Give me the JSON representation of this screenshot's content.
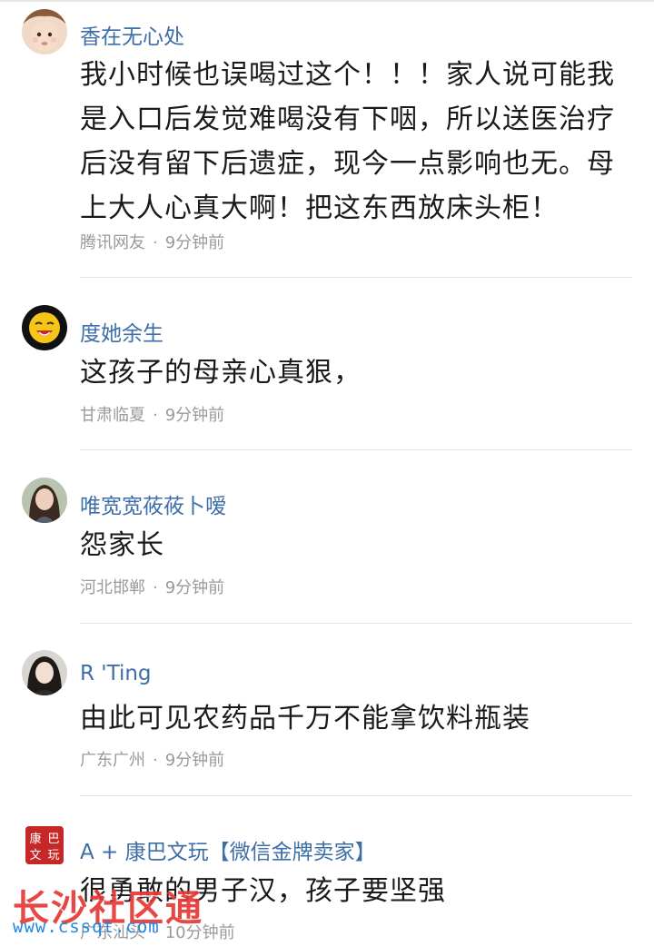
{
  "comments": [
    {
      "username": "香在无心处",
      "lines": [
        "我小时候也误喝过这个！！！家人说可能我",
        "是入口后发觉难喝没有下咽，所以送医治疗",
        "后没有留下后遗症，现今一点影响也无。母",
        "上大人心真大啊！把这东西放床头柜！"
      ],
      "location": "腾讯网友",
      "time": "9分钟前",
      "avatar_icon": "child-avatar-icon"
    },
    {
      "username": "度她余生",
      "lines": [
        "这孩子的母亲心真狠，"
      ],
      "location": "甘肃临夏",
      "time": "9分钟前",
      "avatar_icon": "emoji-avatar-icon"
    },
    {
      "username": "唯宽宽莜莜卜嗳",
      "lines": [
        "怨家长"
      ],
      "location": "河北邯郸",
      "time": "9分钟前",
      "avatar_icon": "woman-avatar-icon"
    },
    {
      "username": "R  'Ting",
      "lines": [
        "由此可见农药品千万不能拿饮料瓶装"
      ],
      "location": "广东广州",
      "time": "9分钟前",
      "avatar_icon": "girl-avatar-icon"
    },
    {
      "username": "A + 康巴文玩【微信金牌卖家】",
      "lines": [
        "很勇敢的男子汉，孩子要坚强"
      ],
      "location": "广东汕头",
      "time": "10分钟前",
      "avatar_icon": "seal-avatar-icon",
      "avatar_text": "康巴文玩"
    }
  ],
  "separator": "·",
  "watermark": {
    "title": "长沙社区通",
    "url": "www.cssqt.com"
  },
  "colors": {
    "username": "#3d6ea8",
    "content": "#1a1a1a",
    "meta": "#9a9a9a",
    "divider": "#e3e3e3",
    "watermark_title": "#e53935",
    "watermark_url": "#1e88e5"
  }
}
